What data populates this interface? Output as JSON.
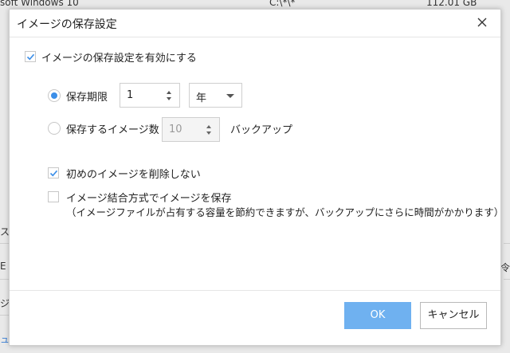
{
  "background": {
    "top_row": {
      "name": "soft Windows 10",
      "path": "C:\\*\\*",
      "size": "112.01 GB"
    },
    "left_fragments": [
      "ス",
      "E",
      "ジ",
      "ュ"
    ],
    "right_fragments": [
      "令"
    ]
  },
  "dialog": {
    "title": "イメージの保存設定",
    "enable_checkbox": {
      "label": "イメージの保存設定を有効にする",
      "checked": true
    },
    "retention_period": {
      "label": "保存期限",
      "selected": true,
      "value": "1",
      "unit": "年"
    },
    "image_count": {
      "label": "保存するイメージ数",
      "selected": false,
      "value": "10",
      "suffix": "バックアップ"
    },
    "keep_first": {
      "label": "初めのイメージを削除しない",
      "checked": true
    },
    "merge": {
      "label": "イメージ結合方式でイメージを保存",
      "note": "（イメージファイルが占有する容量を節約できますが、バックアップにさらに時間がかかります）",
      "checked": false
    },
    "buttons": {
      "ok": "OK",
      "cancel": "キャンセル"
    }
  },
  "colors": {
    "accent": "#3b8ee8",
    "ok_button": "#6fb1f0"
  }
}
